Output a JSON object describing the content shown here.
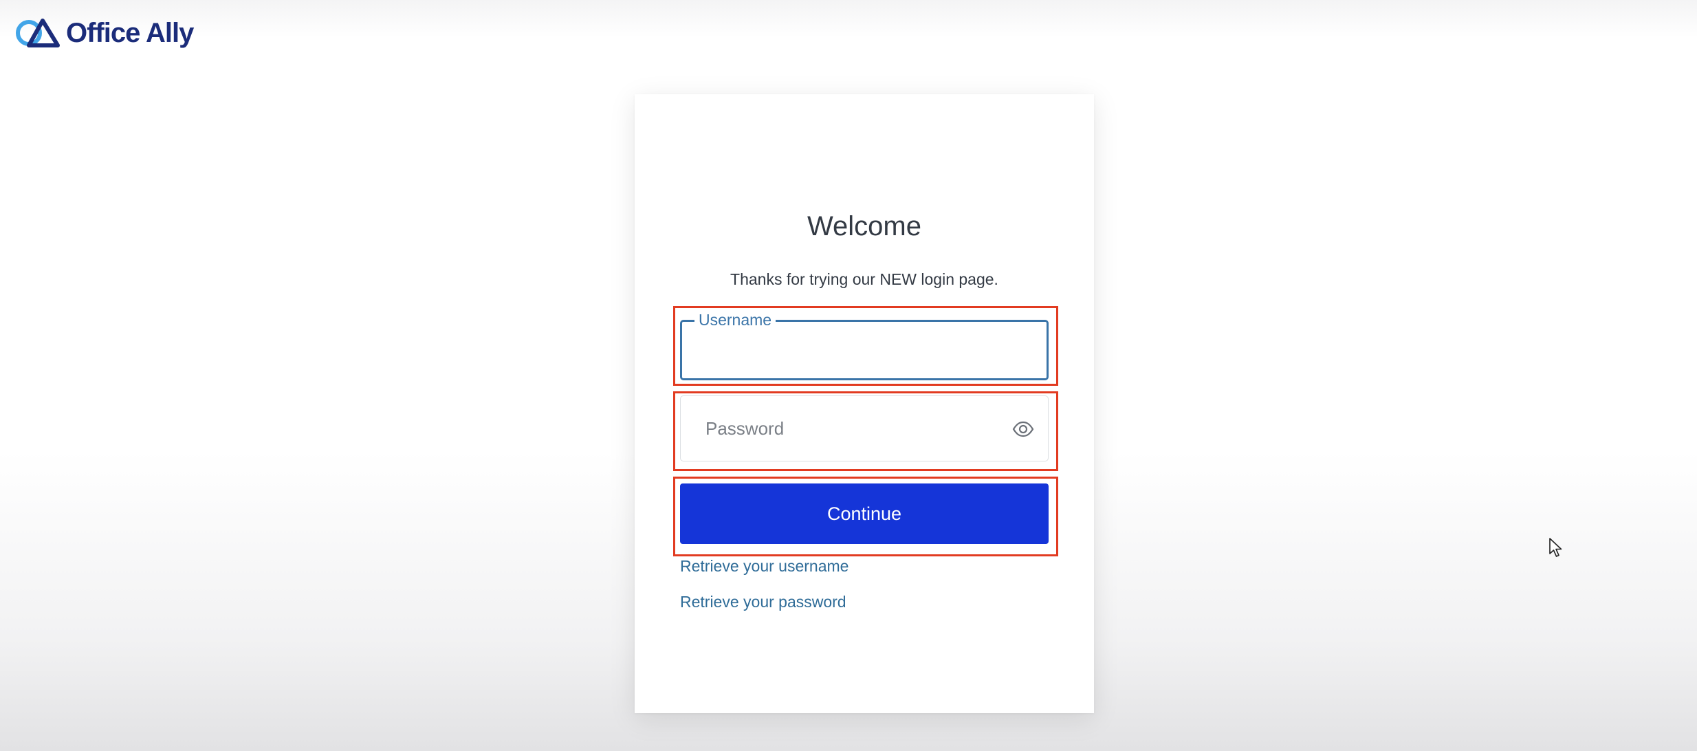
{
  "brand": {
    "name": "Office Ally",
    "logo_icon": "office-ally-logo-mark",
    "colors": {
      "dark": "#1b2c7a",
      "light": "#42a5e8"
    }
  },
  "login": {
    "title": "Welcome",
    "subtitle": "Thanks for trying our NEW login page.",
    "username": {
      "label": "Username",
      "value": ""
    },
    "password": {
      "placeholder": "Password",
      "value": "",
      "toggle_icon": "eye-icon"
    },
    "continue_label": "Continue",
    "links": {
      "retrieve_username": "Retrieve your username",
      "retrieve_password": "Retrieve your password"
    }
  },
  "colors": {
    "primary_button": "#1535d8",
    "link": "#2f6c98",
    "focus_border": "#3a74a8",
    "highlight_annotation": "#e23b21"
  },
  "pointer_icon": "arrow-cursor-icon"
}
